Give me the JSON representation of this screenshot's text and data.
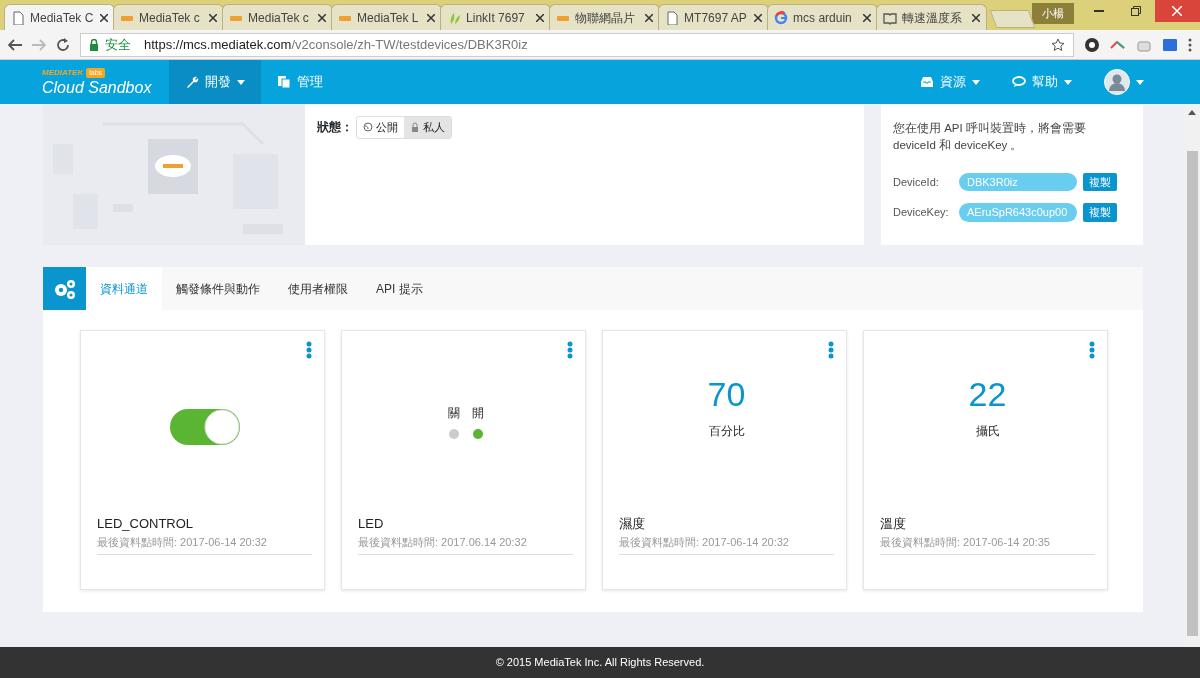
{
  "browser": {
    "tabs": [
      {
        "title": "MediaTek C",
        "kind": "page",
        "selected": true
      },
      {
        "title": "MediaTek c",
        "kind": "mtk",
        "selected": false
      },
      {
        "title": "MediaTek c",
        "kind": "mtk",
        "selected": false
      },
      {
        "title": "MediaTek L",
        "kind": "mtk",
        "selected": false
      },
      {
        "title": "LinkIt 7697",
        "kind": "leaf",
        "selected": false
      },
      {
        "title": "物聯網晶片",
        "kind": "mtk",
        "selected": false
      },
      {
        "title": "MT7697 AP",
        "kind": "page",
        "selected": false
      },
      {
        "title": "mcs arduin",
        "kind": "google",
        "selected": false
      },
      {
        "title": "轉速溫度系",
        "kind": "book",
        "selected": false
      }
    ],
    "profile": "小楊",
    "address": {
      "secure_label": "安全",
      "url_host": "https://mcs.mediatek.com",
      "url_path": "/v2console/zh-TW/testdevices/DBK3R0iz"
    }
  },
  "navbar": {
    "brand_top": "MEDIATEK",
    "brand_badge": "labs",
    "brand_name": "Cloud Sandbox",
    "left": [
      {
        "label": "開發",
        "kind": "wrench",
        "dropdown": true,
        "selected": true
      },
      {
        "label": "管理",
        "kind": "copy",
        "dropdown": false,
        "selected": false
      }
    ],
    "right": [
      {
        "label": "資源",
        "kind": "inbox",
        "dropdown": true
      },
      {
        "label": "幫助",
        "kind": "chat",
        "dropdown": true
      }
    ]
  },
  "device": {
    "status_label": "狀態：",
    "status_options": [
      {
        "label": "公開",
        "kind": "globe",
        "selected": false
      },
      {
        "label": "私人",
        "kind": "lock",
        "selected": true
      }
    ]
  },
  "keys": {
    "note": "您在使用 API 呼叫裝置時，將會需要 deviceId 和 deviceKey 。",
    "fields": [
      {
        "label": "DeviceId:",
        "value": "DBK3R0iz",
        "button": "複製"
      },
      {
        "label": "DeviceKey:",
        "value": "AEruSpR643c0up00",
        "button": "複製"
      }
    ]
  },
  "channel_tabs": [
    {
      "label": "資料通道",
      "selected": true
    },
    {
      "label": "觸發條件與動作",
      "selected": false
    },
    {
      "label": "使用者權限",
      "selected": false
    },
    {
      "label": "API 提示",
      "selected": false
    }
  ],
  "channels": [
    {
      "kind": "switch",
      "name": "LED_CONTROL",
      "updated": "最後資料點時間: 2017-06-14 20:32",
      "on": true
    },
    {
      "kind": "status",
      "name": "LED",
      "updated": "最後資料點時間: 2017.06.14 20:32",
      "options": [
        {
          "label": "關",
          "selected": false
        },
        {
          "label": "開",
          "selected": true
        }
      ]
    },
    {
      "kind": "value",
      "name": "濕度",
      "updated": "最後資料點時間: 2017-06-14 20:32",
      "value": "70",
      "unit": "百分比"
    },
    {
      "kind": "value",
      "name": "溫度",
      "updated": "最後資料點時間: 2017-06-14 20:35",
      "value": "22",
      "unit": "攝氏"
    }
  ],
  "footer": "© 2015 MediaTek Inc. All Rights Reserved."
}
